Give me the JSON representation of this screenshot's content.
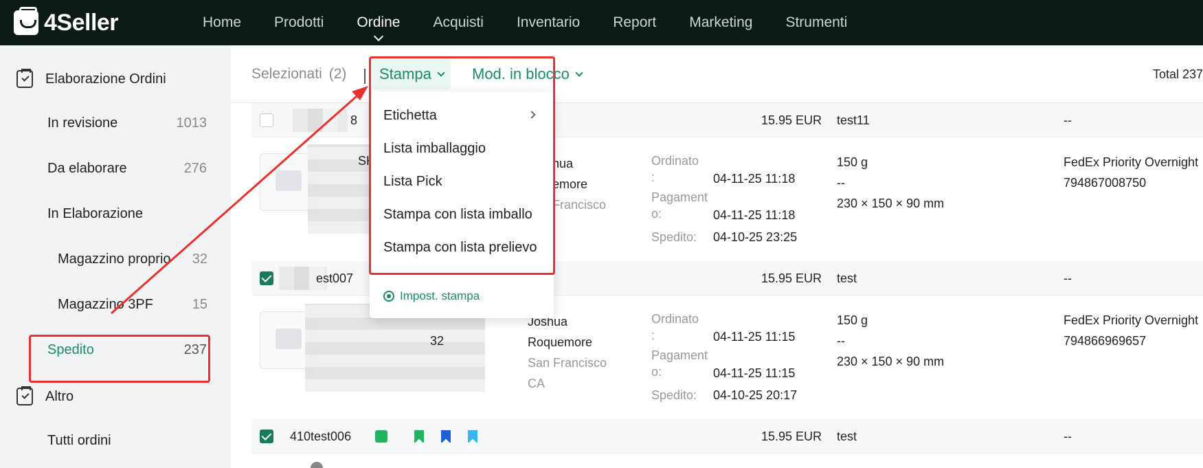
{
  "app": {
    "name": "4Seller"
  },
  "nav": {
    "items": [
      "Home",
      "Prodotti",
      "Ordine",
      "Acquisti",
      "Inventario",
      "Report",
      "Marketing",
      "Strumenti"
    ],
    "active": "Ordine"
  },
  "sidebar": {
    "group1": "Elaborazione Ordini",
    "items": [
      {
        "label": "In revisione",
        "count": "1013"
      },
      {
        "label": "Da elaborare",
        "count": "276"
      },
      {
        "label": "In Elaborazione",
        "count": ""
      },
      {
        "label": "Magazzino proprio",
        "count": "32"
      },
      {
        "label": "Magazzino 3PF",
        "count": "15"
      },
      {
        "label": "Spedito",
        "count": "237"
      }
    ],
    "group2": "Altro",
    "extra": "Tutti ordini"
  },
  "toolbar": {
    "selected_label": "Selezionati",
    "selected_count": "(2)",
    "print_label": "Stampa",
    "bulk_label": "Mod. in blocco",
    "total_label": "Total 237"
  },
  "dropdown": {
    "items": [
      "Etichetta",
      "Lista imballaggio",
      "Lista Pick",
      "Stampa con lista imballo",
      "Stampa con lista prelievo"
    ],
    "settings_label": "Impost. stampa"
  },
  "orders": [
    {
      "id_fragment": "8",
      "amount": "15.95 EUR",
      "store": "test11",
      "tracking_dash": "--",
      "sku_fragment": "SK",
      "buyer_first": "hua",
      "buyer_last": "emore",
      "buyer_city": "Francisco",
      "ordered_label": "Ordinato",
      "ordered_colon": ":",
      "ordered_time": "04-11-25 11:18",
      "paid_label": "Pagament",
      "paid_label2": "o:",
      "paid_time": "04-11-25 11:18",
      "shipped_label": "Spedito:",
      "shipped_time": "04-10-25 23:25",
      "weight": "150 g",
      "weight_dash": "--",
      "dimensions": "230 × 150 × 90 mm",
      "carrier": "FedEx Priority Overnight",
      "tracking": "794867008750",
      "checked": false
    },
    {
      "id_fragment": "est007",
      "amount": "15.95 EUR",
      "store": "test",
      "tracking_dash": "--",
      "sku_fragment": "32",
      "buyer_first": "Joshua",
      "buyer_last": "Roquemore",
      "buyer_city": "San Francisco",
      "buyer_state": "CA",
      "ordered_label": "Ordinato",
      "ordered_colon": ":",
      "ordered_time": "04-11-25 11:15",
      "paid_label": "Pagament",
      "paid_label2": "o:",
      "paid_time": "04-11-25 11:15",
      "shipped_label": "Spedito:",
      "shipped_time": "04-10-25 20:17",
      "weight": "150 g",
      "weight_dash": "--",
      "dimensions": "230 × 150 × 90 mm",
      "carrier": "FedEx Priority Overnight",
      "tracking": "794866969657",
      "checked": true
    },
    {
      "id_fragment": "410test006",
      "amount": "15.95 EUR",
      "store": "test",
      "tracking_dash": "--",
      "checked": true
    }
  ],
  "colors": {
    "nav_bg": "#0c1a14",
    "accent": "#1a8a6a",
    "annotation": "#e8302c",
    "sidebar_bg": "#f2f3f5"
  }
}
